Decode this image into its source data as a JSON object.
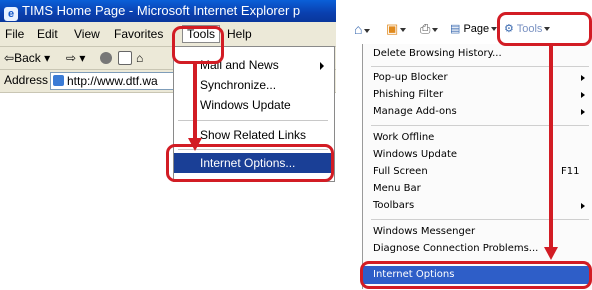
{
  "ie6": {
    "window_title": "TIMS Home Page - Microsoft Internet Explorer p",
    "menu": [
      "File",
      "Edit",
      "View",
      "Favorites",
      "Tools",
      "Help"
    ],
    "toolbar": {
      "back_label": "Back"
    },
    "address": {
      "label": "Address",
      "value": "http://www.dtf.wa"
    },
    "tools_menu": {
      "items": [
        {
          "label": "Mail and News",
          "has_submenu": true
        },
        {
          "label": "Synchronize..."
        },
        {
          "label": "Windows Update"
        },
        {
          "label": "Show Related Links"
        },
        {
          "label": "Internet Options..."
        }
      ]
    }
  },
  "ie7": {
    "command_bar": {
      "page_label": "Page",
      "tools_label": "Tools"
    },
    "tools_menu": {
      "items": [
        {
          "label": "Delete Browsing History..."
        },
        {
          "label": "Pop-up Blocker",
          "has_submenu": true
        },
        {
          "label": "Phishing Filter",
          "has_submenu": true
        },
        {
          "label": "Manage Add-ons",
          "has_submenu": true
        },
        {
          "label": "Work Offline"
        },
        {
          "label": "Windows Update"
        },
        {
          "label": "Full Screen",
          "shortcut": "F11"
        },
        {
          "label": "Menu Bar"
        },
        {
          "label": "Toolbars",
          "has_submenu": true
        },
        {
          "label": "Windows Messenger"
        },
        {
          "label": "Diagnose Connection Problems..."
        },
        {
          "label": "Internet Options"
        }
      ]
    }
  },
  "colors": {
    "annotation_red": "#d21c24",
    "ie6_highlight": "#1a3f96",
    "ie7_highlight": "#2e5ec8",
    "xp_chrome": "#ece9d8"
  },
  "icons": [
    "ie-logo-icon",
    "back-arrow-icon",
    "forward-arrow-icon",
    "stop-icon",
    "refresh-icon",
    "home-icon",
    "page-icon",
    "print-icon",
    "feeds-icon",
    "gear-icon"
  ]
}
